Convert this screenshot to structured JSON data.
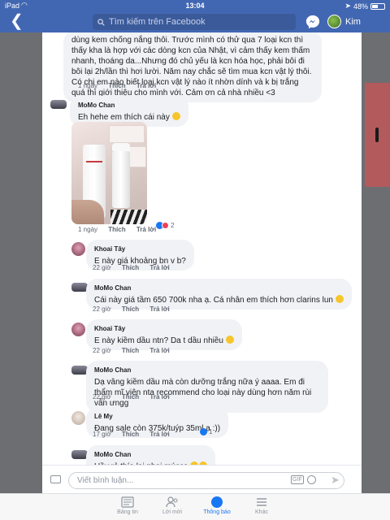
{
  "status_bar": {
    "carrier": "iPad",
    "time": "13:04",
    "battery": "48%",
    "battery_level": 0.48
  },
  "navbar": {
    "search_placeholder": "Tìm kiếm trên Facebook",
    "user_name": "Kim"
  },
  "comments": [
    {
      "text": "dùng kem chống nắng thôi. Trước mình có thử qua 7 loại kcn thì thấy kha là hợp với các dòng kcn của Nhật, vì cảm thấy kem thấm nhanh, thoáng da...Nhưng đó chủ yếu là kcn hóa học, phải bôi đi bôi lại 2h/lần thì hơi lười. Năm nay chắc sẽ tìm mua kcn vật lý thôi. Có chị em nào biết loại kcn vật lý nào ít nhờn dính và k bị trắng quá thì giới thiệu cho mình với. Cảm ơn cả nhà nhiều <3",
      "time": "1 ngày",
      "like": "Thích",
      "reply": "Trả lời"
    },
    {
      "author": "MoMo Chan",
      "text": "Eh hehe em thích cái này",
      "time": "1 ngày",
      "like": "Thích",
      "reply": "Trả lời",
      "reaction_count": "2"
    },
    {
      "author": "Khoai Tây",
      "text": "E này giá khoảng bn v b?",
      "time": "22 giờ",
      "like": "Thích",
      "reply": "Trả lời"
    },
    {
      "author": "MoMo Chan",
      "text": "Cái này giá tầm 650 700k nha ạ. Cá nhân em thích hơn clarins lun",
      "time": "22 giờ",
      "like": "Thích",
      "reply": "Trả lời"
    },
    {
      "author": "Khoai Tây",
      "text": "E này kiềm dầu ntn? Da t dầu nhiều",
      "time": "22 giờ",
      "like": "Thích",
      "reply": "Trả lời"
    },
    {
      "author": "MoMo Chan",
      "text": "Dạ vâng kiềm dầu mà còn dưỡng trắng nữa ý aaaa. Em đi thẩm mĩ viện nta recommend cho loại này dùng hơn năm rùi vẫn ưngg",
      "time": "22 giờ",
      "like": "Thích",
      "reply": "Trả lời"
    },
    {
      "author": "Lê My",
      "text": "Đang sale còn 375k/tuýp 35ml ạ :))",
      "time": "17 giờ",
      "like": "Thích",
      "reply": "Trả lời",
      "reaction_count": "1"
    },
    {
      "author": "MoMo Chan",
      "text": "Uầy rẻ thía lại phại múccc"
    }
  ],
  "composer": {
    "placeholder": "Viết bình luận...",
    "gif": "GIF"
  },
  "tabs": [
    {
      "label": "Bảng tin",
      "icon": "news-feed-icon"
    },
    {
      "label": "Lời mời",
      "icon": "friends-icon"
    },
    {
      "label": "Thông báo",
      "icon": "globe-icon"
    },
    {
      "label": "Khác",
      "icon": "menu-icon"
    }
  ],
  "colors": {
    "brand": "#4267b2",
    "bubble": "#f1f2f6",
    "like": "#1877f2",
    "love": "#f33e58"
  }
}
